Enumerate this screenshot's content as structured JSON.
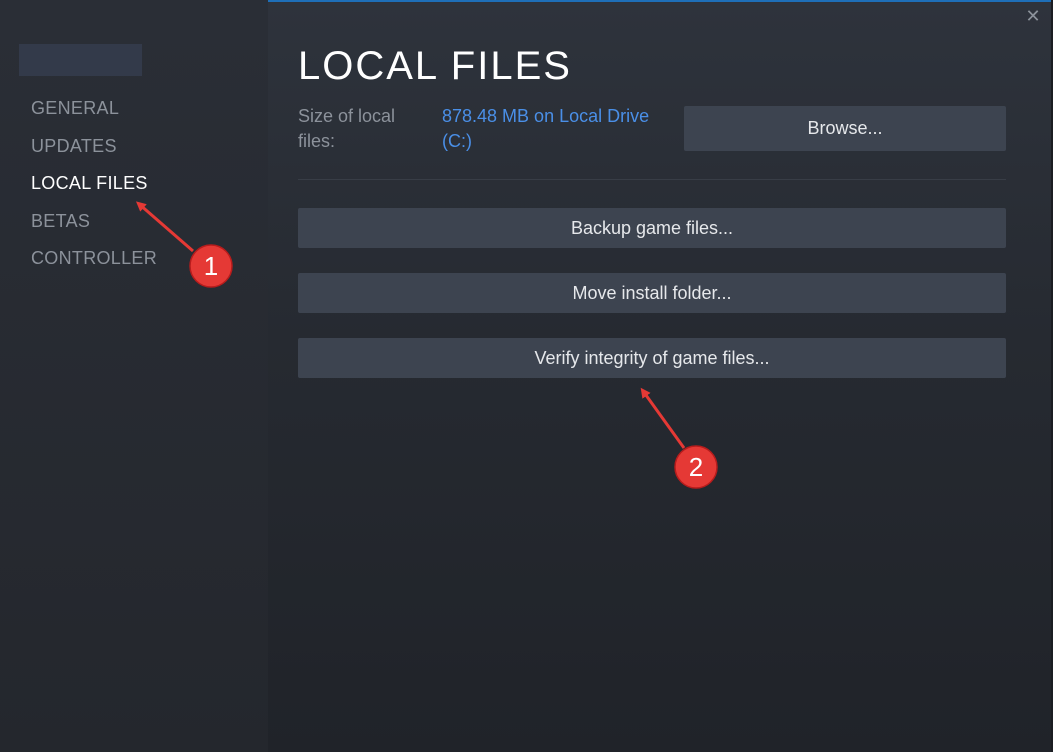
{
  "sidebar": {
    "items": [
      {
        "label": "GENERAL",
        "active": false
      },
      {
        "label": "UPDATES",
        "active": false
      },
      {
        "label": "LOCAL FILES",
        "active": true
      },
      {
        "label": "BETAS",
        "active": false
      },
      {
        "label": "CONTROLLER",
        "active": false
      }
    ]
  },
  "window": {
    "close_icon": "close-icon",
    "close_glyph": "✕"
  },
  "main": {
    "title": "LOCAL FILES",
    "size_label": "Size of local files:",
    "size_value": "878.48 MB on Local Drive (C:)",
    "browse_label": "Browse...",
    "backup_label": "Backup game files...",
    "move_label": "Move install folder...",
    "verify_label": "Verify integrity of game files..."
  },
  "annotations": [
    {
      "number": "1"
    },
    {
      "number": "2"
    }
  ],
  "colors": {
    "accent": "#1e6fb8",
    "link": "#4a8fe7",
    "annotation": "#e53935",
    "button_bg": "#3d4450"
  }
}
